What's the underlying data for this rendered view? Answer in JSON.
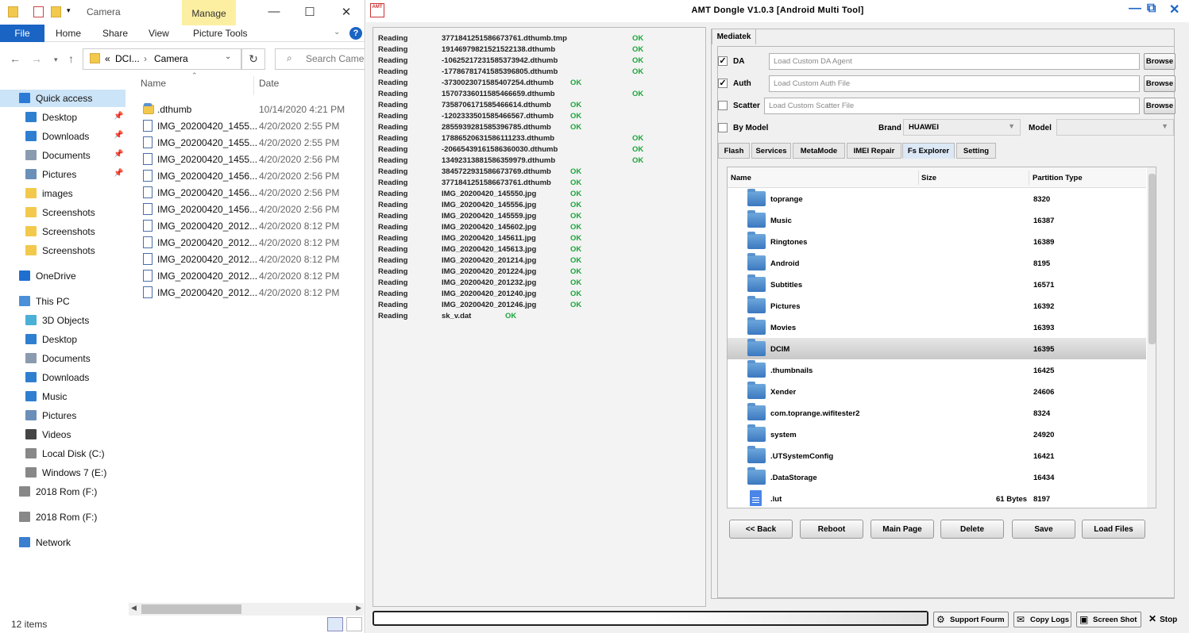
{
  "explorer": {
    "title": "Camera",
    "manage_label": "Manage",
    "ribbon_tabs": [
      "File",
      "Home",
      "Share",
      "View",
      "Picture Tools"
    ],
    "help_label": "?",
    "address": {
      "prefix": "«",
      "crumb1": "DCI...",
      "sep": "›",
      "crumb2": "Camera"
    },
    "search_placeholder": "Search Camera",
    "columns": {
      "name": "Name",
      "date": "Date"
    },
    "nav": [
      {
        "label": "Quick access",
        "icon": "star-icon"
      },
      {
        "label": "Desktop",
        "icon": "desktop-icon",
        "pinned": true
      },
      {
        "label": "Downloads",
        "icon": "download-icon",
        "pinned": true
      },
      {
        "label": "Documents",
        "icon": "documents-icon",
        "pinned": true
      },
      {
        "label": "Pictures",
        "icon": "pictures-icon",
        "pinned": true
      },
      {
        "label": "images",
        "icon": "folder-icon"
      },
      {
        "label": "Screenshots",
        "icon": "folder-icon"
      },
      {
        "label": "Screenshots",
        "icon": "folder-icon"
      },
      {
        "label": "Screenshots",
        "icon": "folder-icon"
      },
      {
        "label": "OneDrive",
        "icon": "cloud-icon"
      },
      {
        "label": "This PC",
        "icon": "computer-icon"
      },
      {
        "label": "3D Objects",
        "icon": "cube-icon"
      },
      {
        "label": "Desktop",
        "icon": "desktop-icon"
      },
      {
        "label": "Documents",
        "icon": "documents-icon"
      },
      {
        "label": "Downloads",
        "icon": "download-icon"
      },
      {
        "label": "Music",
        "icon": "music-icon"
      },
      {
        "label": "Pictures",
        "icon": "pictures-icon"
      },
      {
        "label": "Videos",
        "icon": "video-icon"
      },
      {
        "label": "Local Disk (C:)",
        "icon": "drive-icon"
      },
      {
        "label": "Windows 7 (E:)",
        "icon": "drive-icon"
      },
      {
        "label": "2018 Rom (F:)",
        "icon": "drive-icon"
      },
      {
        "label": "2018 Rom (F:)",
        "icon": "drive-icon"
      },
      {
        "label": "Network",
        "icon": "network-icon"
      }
    ],
    "files": [
      {
        "name": ".dthumb",
        "date": "10/14/2020 4:21 PM",
        "folder": true
      },
      {
        "name": "IMG_20200420_1455...",
        "date": "4/20/2020 2:55 PM"
      },
      {
        "name": "IMG_20200420_1455...",
        "date": "4/20/2020 2:55 PM"
      },
      {
        "name": "IMG_20200420_1455...",
        "date": "4/20/2020 2:56 PM"
      },
      {
        "name": "IMG_20200420_1456...",
        "date": "4/20/2020 2:56 PM"
      },
      {
        "name": "IMG_20200420_1456...",
        "date": "4/20/2020 2:56 PM"
      },
      {
        "name": "IMG_20200420_1456...",
        "date": "4/20/2020 2:56 PM"
      },
      {
        "name": "IMG_20200420_2012...",
        "date": "4/20/2020 8:12 PM"
      },
      {
        "name": "IMG_20200420_2012...",
        "date": "4/20/2020 8:12 PM"
      },
      {
        "name": "IMG_20200420_2012...",
        "date": "4/20/2020 8:12 PM"
      },
      {
        "name": "IMG_20200420_2012...",
        "date": "4/20/2020 8:12 PM"
      },
      {
        "name": "IMG_20200420_2012...",
        "date": "4/20/2020 8:12 PM"
      }
    ],
    "status": "12 items"
  },
  "amt": {
    "title": "AMT Dongle V1.0.3 [Android Multi Tool]",
    "logo_text": "AMT",
    "log": [
      {
        "action": "Reading",
        "item": "3771841251586673761.dthumb.tmp",
        "status": "OK",
        "ok_far": true
      },
      {
        "action": "Reading",
        "item": "1914697982152152213​8.dthumb",
        "status": "OK",
        "ok_far": true
      },
      {
        "action": "Reading",
        "item": "-10625217231585373942.dthumb",
        "status": "OK",
        "ok_far": true
      },
      {
        "action": "Reading",
        "item": "-17786781741585396805.dthumb",
        "status": "OK",
        "ok_far": true
      },
      {
        "action": "Reading",
        "item": "-3730023071585407254.dthumb",
        "status": "OK"
      },
      {
        "action": "Reading",
        "item": "1570733601158546665​9.dthumb",
        "status": "OK",
        "ok_far": true
      },
      {
        "action": "Reading",
        "item": "735870617158546661​4.dthumb",
        "status": "OK"
      },
      {
        "action": "Reading",
        "item": "-1202333501585466567.dthumb",
        "status": "OK"
      },
      {
        "action": "Reading",
        "item": "285593928158539678​5.dthumb",
        "status": "OK"
      },
      {
        "action": "Reading",
        "item": "1788652063158611123​3.dthumb",
        "status": "OK",
        "ok_far": true
      },
      {
        "action": "Reading",
        "item": "-20665439161586360030.dthumb",
        "status": "OK",
        "ok_far": true
      },
      {
        "action": "Reading",
        "item": "1349231388158635997​9.dthumb",
        "status": "OK",
        "ok_far": true
      },
      {
        "action": "Reading",
        "item": "384572293158667376​9.dthumb",
        "status": "OK"
      },
      {
        "action": "Reading",
        "item": "377184125158667376​1.dthumb",
        "status": "OK"
      },
      {
        "action": "Reading",
        "item": "IMG_20200420_145550.jpg",
        "status": "OK"
      },
      {
        "action": "Reading",
        "item": "IMG_20200420_145556.jpg",
        "status": "OK"
      },
      {
        "action": "Reading",
        "item": "IMG_20200420_145559.jpg",
        "status": "OK"
      },
      {
        "action": "Reading",
        "item": "IMG_20200420_145602.jpg",
        "status": "OK"
      },
      {
        "action": "Reading",
        "item": "IMG_20200420_145611.jpg",
        "status": "OK"
      },
      {
        "action": "Reading",
        "item": "IMG_20200420_145613.jpg",
        "status": "OK"
      },
      {
        "action": "Reading",
        "item": "IMG_20200420_201214.jpg",
        "status": "OK"
      },
      {
        "action": "Reading",
        "item": "IMG_20200420_201224.jpg",
        "status": "OK"
      },
      {
        "action": "Reading",
        "item": "IMG_20200420_201232.jpg",
        "status": "OK"
      },
      {
        "action": "Reading",
        "item": "IMG_20200420_201240.jpg",
        "status": "OK"
      },
      {
        "action": "Reading",
        "item": "IMG_20200420_201246.jpg",
        "status": "OK"
      },
      {
        "action": "Reading",
        "item": "sk_v.dat",
        "status": "OK",
        "ok_short": true
      }
    ],
    "main_tab": "Mediatek",
    "da": {
      "label": "DA",
      "checked": true,
      "placeholder": "Load Custom DA Agent"
    },
    "auth": {
      "label": "Auth",
      "checked": true,
      "placeholder": "Load Custom Auth File"
    },
    "scatter": {
      "label": "Scatter",
      "checked": false,
      "placeholder": "Load Custom Scatter File"
    },
    "browse_label": "Browse",
    "by_model": {
      "label": "By Model",
      "checked": false
    },
    "brand": {
      "label": "Brand",
      "value": "HUAWEI"
    },
    "model": {
      "label": "Model",
      "value": ""
    },
    "sub_tabs": [
      "Flash",
      "Services",
      "MetaMode",
      "IMEI Repair",
      "Fs Explorer",
      "Setting"
    ],
    "active_sub_tab": "Fs Explorer",
    "fs": {
      "headers": {
        "name": "Name",
        "size": "Size",
        "ptype": "Partition Type"
      },
      "rows": [
        {
          "name": "toprange",
          "size": "",
          "ptype": "8320",
          "type": "folder"
        },
        {
          "name": "Music",
          "size": "",
          "ptype": "16387",
          "type": "folder"
        },
        {
          "name": "Ringtones",
          "size": "",
          "ptype": "16389",
          "type": "folder"
        },
        {
          "name": "Android",
          "size": "",
          "ptype": "8195",
          "type": "folder"
        },
        {
          "name": "Subtitles",
          "size": "",
          "ptype": "16571",
          "type": "folder"
        },
        {
          "name": "Pictures",
          "size": "",
          "ptype": "16392",
          "type": "folder"
        },
        {
          "name": "Movies",
          "size": "",
          "ptype": "16393",
          "type": "folder"
        },
        {
          "name": "DCIM",
          "size": "",
          "ptype": "16395",
          "type": "folder",
          "selected": true
        },
        {
          "name": ".thumbnails",
          "size": "",
          "ptype": "16425",
          "type": "folder"
        },
        {
          "name": "Xender",
          "size": "",
          "ptype": "24606",
          "type": "folder"
        },
        {
          "name": "com.toprange.wifitester2",
          "size": "",
          "ptype": "8324",
          "type": "folder"
        },
        {
          "name": "system",
          "size": "",
          "ptype": "24920",
          "type": "folder"
        },
        {
          "name": ".UTSystemConfig",
          "size": "",
          "ptype": "16421",
          "type": "folder"
        },
        {
          "name": ".DataStorage",
          "size": "",
          "ptype": "16434",
          "type": "folder"
        },
        {
          "name": ".lut",
          "size": "61 Bytes",
          "ptype": "8197",
          "type": "file"
        }
      ]
    },
    "actions": [
      "<< Back",
      "Reboot",
      "Main Page",
      "Delete",
      "Save",
      "Load Files"
    ],
    "bottom": {
      "support": "Support Fourm",
      "copy": "Copy Logs",
      "shot": "Screen Shot",
      "stop": "Stop"
    },
    "colors": {
      "ok": "#1aa53a",
      "accent": "#1a64c4"
    }
  }
}
